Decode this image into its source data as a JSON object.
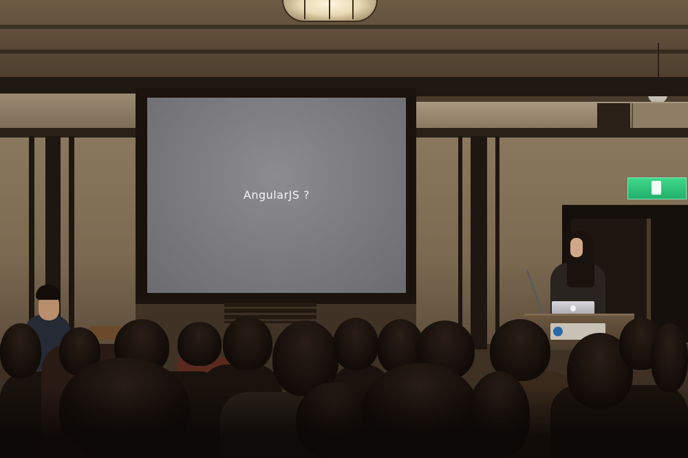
{
  "scene": {
    "description_colors": {
      "ceiling": "#5e4e3a",
      "wall": "#8a785e",
      "screen": "#7c7c80",
      "exit_sign": "#22b06a",
      "audience": "#120c08"
    }
  },
  "projection_screen": {
    "slide_text": "AngularJS ?"
  }
}
